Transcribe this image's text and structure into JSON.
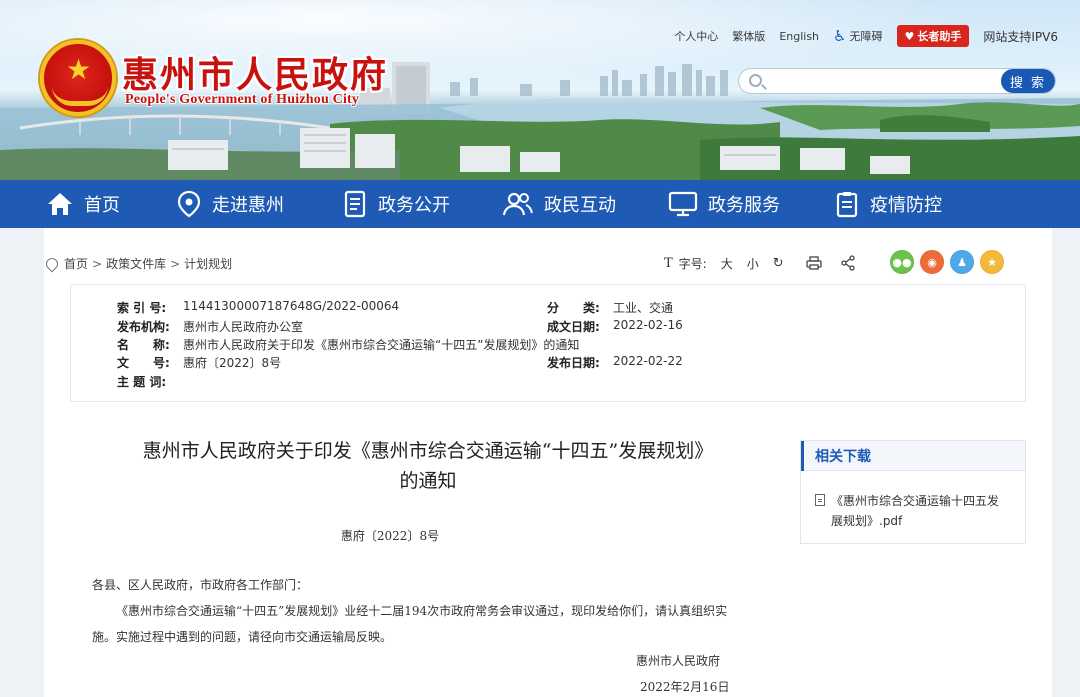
{
  "header": {
    "brand_cn": "惠州市人民政府",
    "brand_en": "People's Government of Huizhou City",
    "links": [
      "个人中心",
      "繁体版",
      "English"
    ],
    "accessibility": "无障碍",
    "elder_mode": "长者助手",
    "ipv6": "网站支持IPV6",
    "search_placeholder": "",
    "search_button": "搜 索",
    "colors": {
      "brand_red": "#c7120d",
      "nav_blue": "#1f5bb5"
    }
  },
  "nav": [
    {
      "label": "首页",
      "icon": "home-icon"
    },
    {
      "label": "走进惠州",
      "icon": "location-pin-icon"
    },
    {
      "label": "政务公开",
      "icon": "document-icon"
    },
    {
      "label": "政民互动",
      "icon": "people-icon"
    },
    {
      "label": "政务服务",
      "icon": "monitor-icon"
    },
    {
      "label": "疫情防控",
      "icon": "clipboard-icon"
    }
  ],
  "breadcrumb": [
    "首页",
    "政策文件库",
    "计划规划"
  ],
  "tools": {
    "font_label": "字号:",
    "large": "大",
    "small": "小",
    "reset": "↻"
  },
  "meta": {
    "index_no_label": "索 引 号:",
    "index_no": "11441300007187648G/2022-00064",
    "category_label": "分　　类:",
    "category": "工业、交通",
    "issuer_label": "发布机构:",
    "issuer": "惠州市人民政府办公室",
    "written_date_label": "成文日期:",
    "written_date": "2022-02-16",
    "name_label": "名　　称:",
    "name": "惠州市人民政府关于印发《惠州市综合交通运输“十四五”发展规划》的通知",
    "doc_no_label": "文　　号:",
    "doc_no": "惠府〔2022〕8号",
    "publish_date_label": "发布日期:",
    "publish_date": "2022-02-22",
    "subject_label": "主 题 词:",
    "subject": ""
  },
  "article": {
    "title_line1": "惠州市人民政府关于印发《惠州市综合交通运输“十四五”发展规划》",
    "title_line2": "的通知",
    "doc_no": "惠府〔2022〕8号",
    "salutation": "各县、区人民政府，市政府各工作部门：",
    "body_line1": "《惠州市综合交通运输“十四五”发展规划》业经十二届194次市政府常务会审议通过，现印发给你们，请认真组织实",
    "body_line2": "施。实施过程中遇到的问题，请径向市交通运输局反映。",
    "signature": "惠州市人民政府",
    "date": "2022年2月16日"
  },
  "sidebar": {
    "title": "相关下载",
    "download_line1": "《惠州市综合交通运输十四五发",
    "download_line2": "展规划》.pdf"
  }
}
